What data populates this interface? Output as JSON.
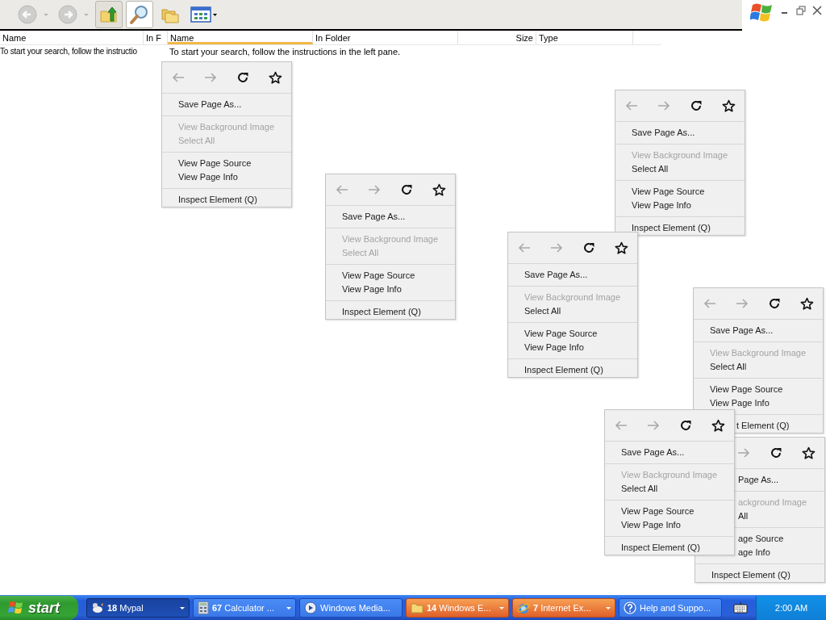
{
  "toolbar": [
    {
      "kind": "back",
      "disabled": true,
      "selected": false,
      "hovered": false
    },
    {
      "kind": "forward",
      "disabled": true,
      "selected": false,
      "hovered": false
    },
    {
      "kind": "up",
      "disabled": false,
      "selected": false,
      "hovered": true
    },
    {
      "kind": "search",
      "disabled": false,
      "selected": true,
      "hovered": false
    },
    {
      "kind": "folders",
      "disabled": false,
      "selected": false,
      "hovered": false
    },
    {
      "kind": "views",
      "disabled": false,
      "selected": false,
      "hovered": false
    }
  ],
  "back_list": {
    "columns": [
      "Name",
      "In F"
    ],
    "message": "To start your search, follow the instructio"
  },
  "results_list": {
    "columns": [
      {
        "label": "Name",
        "sorted": true
      },
      {
        "label": "In Folder",
        "sorted": false
      },
      {
        "label": "Size",
        "sorted": false
      },
      {
        "label": "Type",
        "sorted": false
      }
    ],
    "message": "To start your search, follow the instructions in the left pane."
  },
  "context_menus": [
    {
      "back_covered": false,
      "sections": [
        [
          {
            "label": "Save Page As...",
            "disabled": false,
            "cut": false
          }
        ],
        [
          {
            "label": "View Background Image",
            "disabled": true,
            "cut": false
          },
          {
            "label": "Select All",
            "disabled": true,
            "cut": false
          }
        ],
        [
          {
            "label": "View Page Source",
            "disabled": false,
            "cut": false
          },
          {
            "label": "View Page Info",
            "disabled": false,
            "cut": false
          }
        ],
        [
          {
            "label": "Inspect Element (Q)",
            "disabled": false,
            "cut": false
          }
        ]
      ]
    },
    {
      "back_covered": false,
      "sections": [
        [
          {
            "label": "Save Page As...",
            "disabled": false,
            "cut": false
          }
        ],
        [
          {
            "label": "View Background Image",
            "disabled": true,
            "cut": false
          },
          {
            "label": "Select All",
            "disabled": true,
            "cut": false
          }
        ],
        [
          {
            "label": "View Page Source",
            "disabled": false,
            "cut": false
          },
          {
            "label": "View Page Info",
            "disabled": false,
            "cut": false
          }
        ],
        [
          {
            "label": "Inspect Element (Q)",
            "disabled": false,
            "cut": false
          }
        ]
      ]
    },
    {
      "back_covered": false,
      "sections": [
        [
          {
            "label": "Save Page As...",
            "disabled": false,
            "cut": false
          }
        ],
        [
          {
            "label": "View Background Image",
            "disabled": true,
            "cut": false
          },
          {
            "label": "Select All",
            "disabled": false,
            "cut": false
          }
        ],
        [
          {
            "label": "View Page Source",
            "disabled": false,
            "cut": false
          },
          {
            "label": "View Page Info",
            "disabled": false,
            "cut": false
          }
        ],
        [
          {
            "label": "Inspect Element (Q)",
            "disabled": false,
            "cut": false
          }
        ]
      ]
    },
    {
      "back_covered": false,
      "sections": [
        [
          {
            "label": "Save Page As...",
            "disabled": false,
            "cut": false
          }
        ],
        [
          {
            "label": "View Background Image",
            "disabled": true,
            "cut": false
          },
          {
            "label": "Select All",
            "disabled": false,
            "cut": false
          }
        ],
        [
          {
            "label": "View Page Source",
            "disabled": false,
            "cut": false
          },
          {
            "label": "View Page Info",
            "disabled": false,
            "cut": false
          }
        ],
        [
          {
            "label": "Inspect Element (Q)",
            "disabled": false,
            "cut": false
          }
        ]
      ]
    },
    {
      "back_covered": false,
      "sections": [
        [
          {
            "label": "Save Page As...",
            "disabled": false,
            "cut": false
          }
        ],
        [
          {
            "label": "View Background Image",
            "disabled": true,
            "cut": false
          },
          {
            "label": "Select All",
            "disabled": false,
            "cut": false
          }
        ],
        [
          {
            "label": "View Page Source",
            "disabled": false,
            "cut": false
          },
          {
            "label": "View Page Info",
            "disabled": false,
            "cut": false
          }
        ],
        [
          {
            "label": "t Element (Q)",
            "disabled": false,
            "cut": true
          }
        ]
      ]
    },
    {
      "back_covered": false,
      "sections": [
        [
          {
            "label": "Save Page As...",
            "disabled": false,
            "cut": false
          }
        ],
        [
          {
            "label": "View Background Image",
            "disabled": true,
            "cut": false
          },
          {
            "label": "Select All",
            "disabled": false,
            "cut": false
          }
        ],
        [
          {
            "label": "View Page Source",
            "disabled": false,
            "cut": false
          },
          {
            "label": "View Page Info",
            "disabled": false,
            "cut": false
          }
        ],
        [
          {
            "label": "Inspect Element (Q)",
            "disabled": false,
            "cut": false
          }
        ]
      ]
    },
    {
      "back_covered": true,
      "sections": [
        [
          {
            "label": "Page As...",
            "disabled": false,
            "cut": true
          }
        ],
        [
          {
            "label": "ackground Image",
            "disabled": true,
            "cut": true
          },
          {
            "label": "All",
            "disabled": false,
            "cut": true
          }
        ],
        [
          {
            "label": "age Source",
            "disabled": false,
            "cut": true
          },
          {
            "label": "age Info",
            "disabled": false,
            "cut": true
          }
        ],
        [
          {
            "label": "Inspect Element (Q)",
            "disabled": false,
            "cut": false
          }
        ]
      ]
    }
  ],
  "taskbar": {
    "start": "start",
    "buttons": [
      {
        "kind": "mypal",
        "count": "18",
        "label": "Mypal",
        "grouped": true,
        "selected": true,
        "flashing": false
      },
      {
        "kind": "calculator",
        "count": "67",
        "label": "Calculator ...",
        "grouped": true,
        "selected": false,
        "flashing": false
      },
      {
        "kind": "media",
        "label": "Windows Media...",
        "grouped": false,
        "selected": false,
        "flashing": false
      },
      {
        "kind": "folder",
        "count": "14",
        "label": "Windows E...",
        "grouped": true,
        "selected": false,
        "flashing": true
      },
      {
        "kind": "ie",
        "count": "7",
        "label": "Internet Ex...",
        "grouped": true,
        "selected": false,
        "flashing": true
      },
      {
        "kind": "help",
        "label": "Help and Suppo...",
        "grouped": false,
        "selected": false,
        "flashing": false
      }
    ],
    "clock": "2:00 AM"
  }
}
